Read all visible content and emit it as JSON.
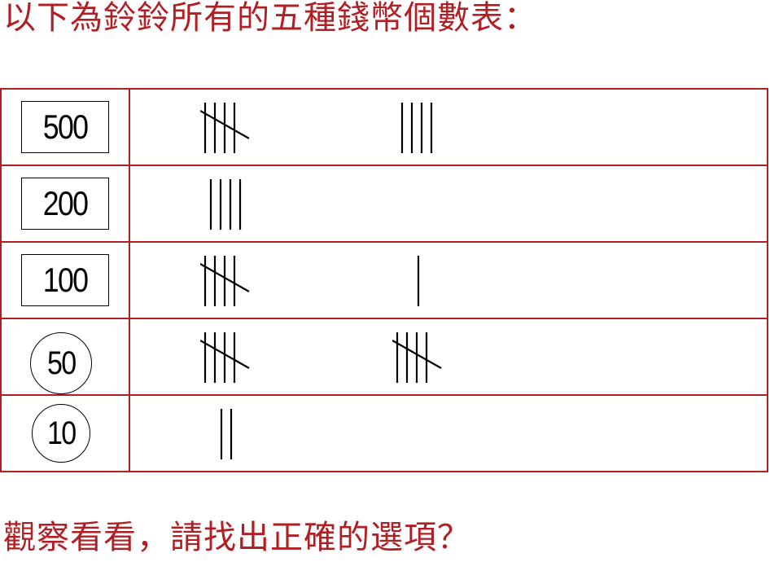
{
  "title": "以下為鈴鈴所有的五種錢幣個數表：",
  "question": "觀察看看，請找出正確的選項？",
  "coins": [
    {
      "label": "500",
      "shape": "rectangle",
      "counts": [
        5,
        4
      ]
    },
    {
      "label": "200",
      "shape": "rectangle",
      "counts": [
        4
      ]
    },
    {
      "label": "100",
      "shape": "rectangle",
      "counts": [
        5,
        1
      ]
    },
    {
      "label": "50",
      "shape": "circle",
      "counts": [
        5,
        5
      ]
    },
    {
      "label": "10",
      "shape": "circle",
      "counts": [
        2
      ]
    }
  ],
  "colors": {
    "accent": "#b01f24",
    "ink": "#000000"
  }
}
